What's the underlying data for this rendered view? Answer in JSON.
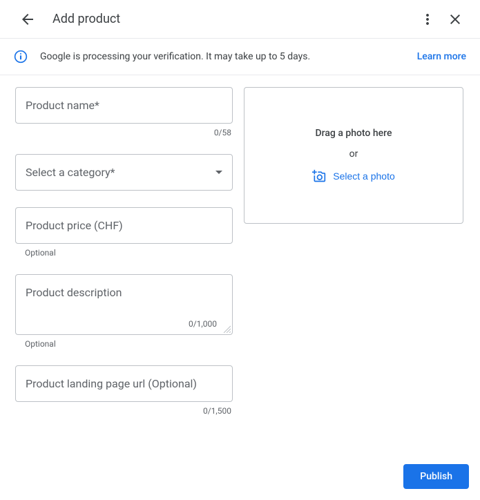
{
  "header": {
    "title": "Add product"
  },
  "notice": {
    "text": "Google is processing your verification. It may take up to 5 days.",
    "link": "Learn more"
  },
  "photoBox": {
    "dragText": "Drag a photo here",
    "orText": "or",
    "selectText": "Select a photo"
  },
  "fields": {
    "productName": {
      "label": "Product name*",
      "counter": "0/58"
    },
    "category": {
      "label": "Select a category*"
    },
    "price": {
      "label": "Product price (CHF)",
      "helper": "Optional"
    },
    "description": {
      "label": "Product description",
      "counter": "0/1,000",
      "helper": "Optional"
    },
    "landingPage": {
      "label": "Product landing page url (Optional)",
      "counter": "0/1,500"
    }
  },
  "buttons": {
    "publish": "Publish"
  }
}
